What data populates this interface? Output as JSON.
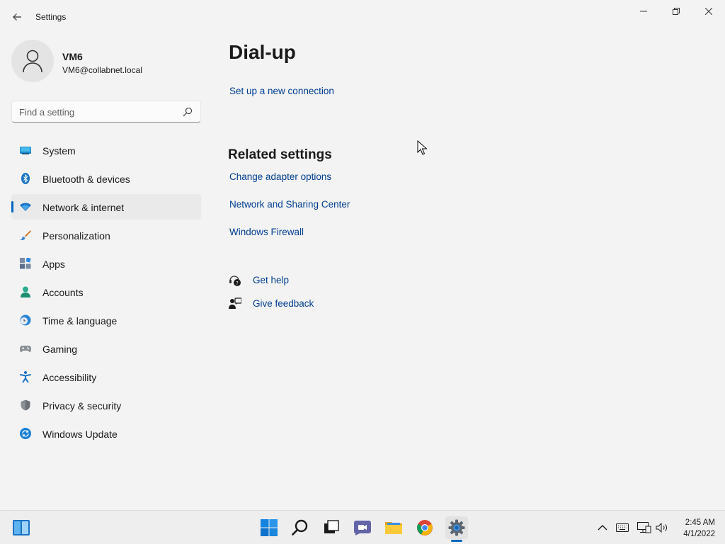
{
  "window": {
    "title": "Settings",
    "back_icon": "arrow-left-icon",
    "minimize_icon": "minimize-icon",
    "maximize_icon": "restore-icon",
    "close_icon": "close-icon"
  },
  "profile": {
    "name": "VM6",
    "email": "VM6@collabnet.local",
    "avatar_icon": "person-icon"
  },
  "search": {
    "placeholder": "Find a setting",
    "value": "",
    "icon": "search-icon"
  },
  "sidebar": {
    "items": [
      {
        "label": "System",
        "icon": "monitor-icon",
        "active": false
      },
      {
        "label": "Bluetooth & devices",
        "icon": "bluetooth-icon",
        "active": false
      },
      {
        "label": "Network & internet",
        "icon": "wifi-icon",
        "active": true
      },
      {
        "label": "Personalization",
        "icon": "brush-icon",
        "active": false
      },
      {
        "label": "Apps",
        "icon": "apps-icon",
        "active": false
      },
      {
        "label": "Accounts",
        "icon": "accounts-icon",
        "active": false
      },
      {
        "label": "Time & language",
        "icon": "globe-clock-icon",
        "active": false
      },
      {
        "label": "Gaming",
        "icon": "gamepad-icon",
        "active": false
      },
      {
        "label": "Accessibility",
        "icon": "accessibility-icon",
        "active": false
      },
      {
        "label": "Privacy & security",
        "icon": "shield-icon",
        "active": false
      },
      {
        "label": "Windows Update",
        "icon": "update-icon",
        "active": false
      }
    ]
  },
  "main": {
    "title": "Dial-up",
    "setup_link": "Set up a new connection",
    "related": {
      "title": "Related settings",
      "links": [
        "Change adapter options",
        "Network and Sharing Center",
        "Windows Firewall"
      ]
    },
    "help": {
      "get_help": "Get help",
      "give_feedback": "Give feedback"
    }
  },
  "taskbar": {
    "widgets_icon": "widgets-icon",
    "apps": [
      "start-icon",
      "search-icon",
      "task-view-icon",
      "chat-icon",
      "file-explorer-icon",
      "chrome-icon",
      "settings-icon"
    ],
    "active_app": "settings-icon",
    "tray": [
      "chevron-up-icon",
      "keyboard-icon",
      "network-icon",
      "volume-icon"
    ],
    "time": "2:45 AM",
    "date": "4/1/2022"
  },
  "colors": {
    "accent": "#0067c0",
    "link": "#003e92",
    "background": "#f3f3f3"
  }
}
